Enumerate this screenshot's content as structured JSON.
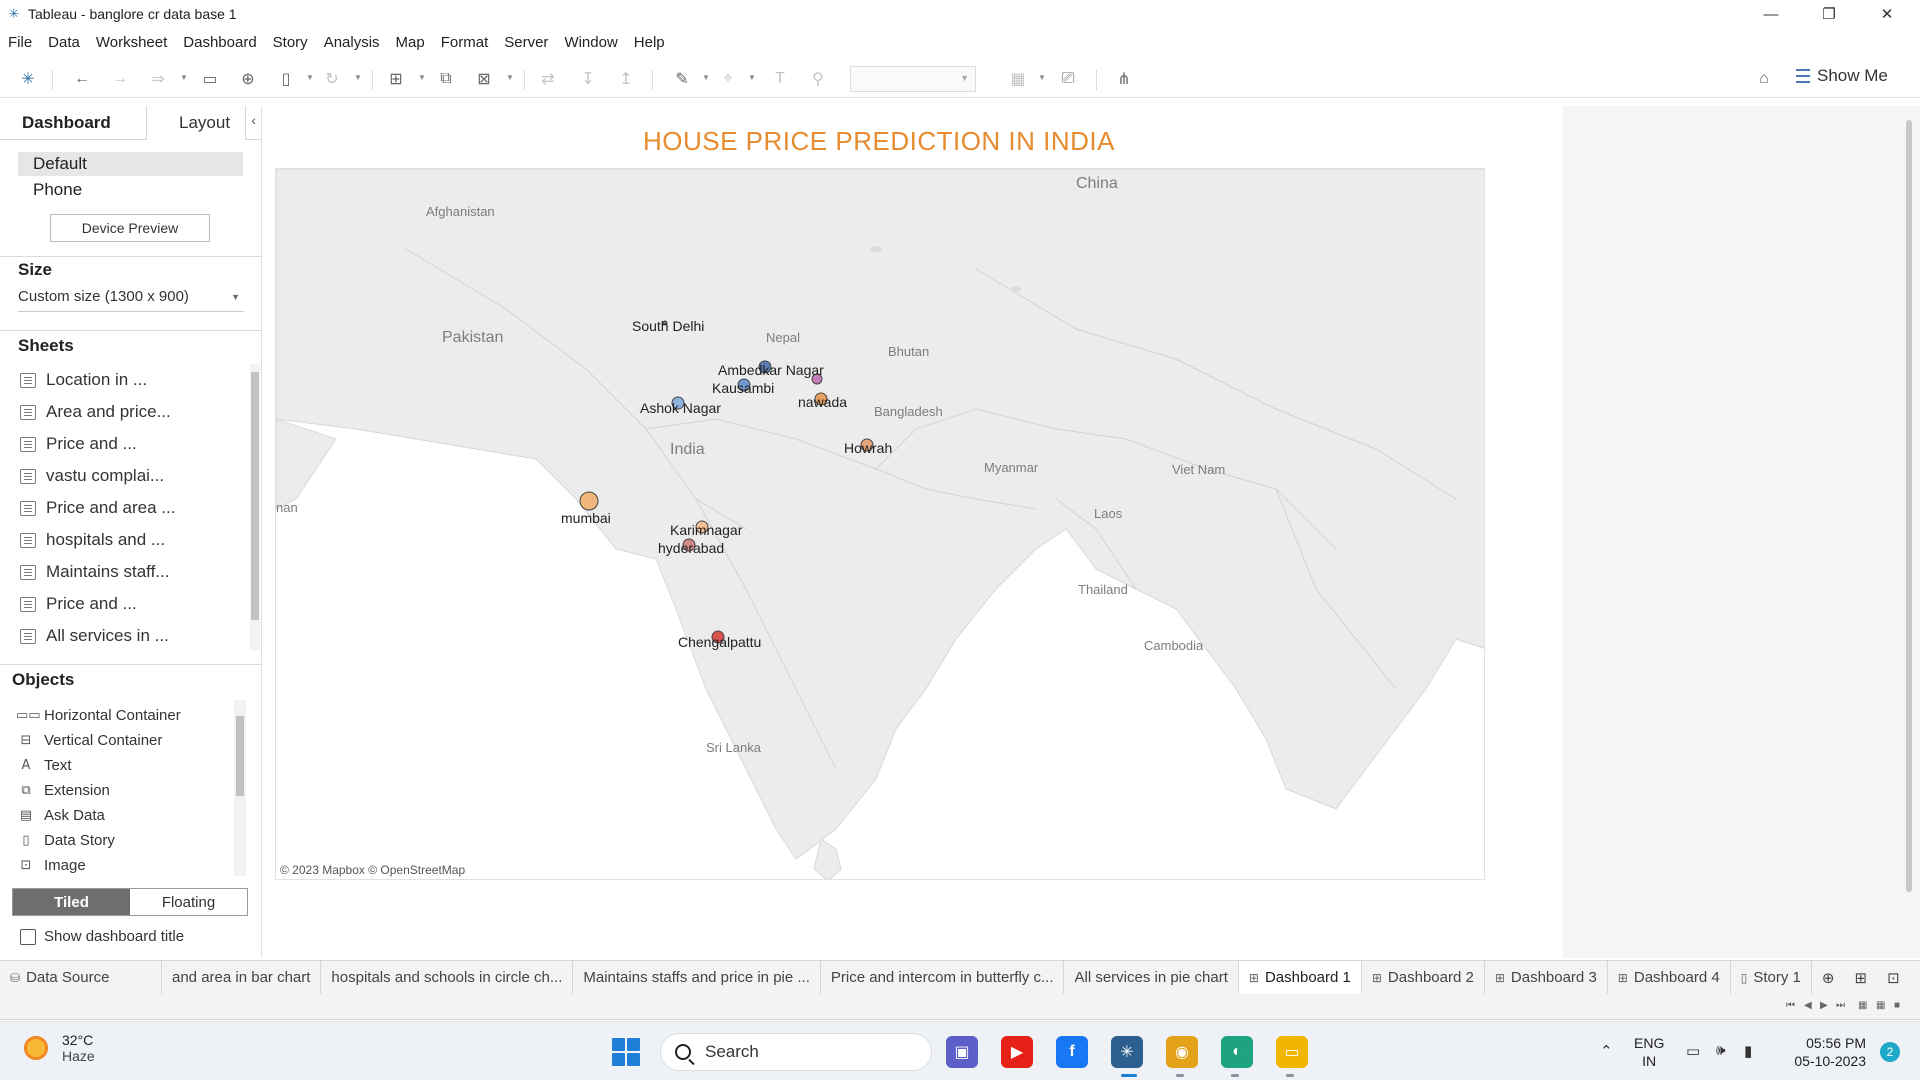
{
  "window": {
    "title": "Tableau - banglore cr data base 1",
    "minimize": "—",
    "maximize": "❐",
    "close": "✕"
  },
  "menu": [
    "File",
    "Data",
    "Worksheet",
    "Dashboard",
    "Story",
    "Analysis",
    "Map",
    "Format",
    "Server",
    "Window",
    "Help"
  ],
  "toolbar": {
    "show_me_label": "Show Me"
  },
  "left_panel": {
    "tabs": {
      "dashboard": "Dashboard",
      "layout": "Layout"
    },
    "devices": {
      "default": "Default",
      "phone": "Phone",
      "preview_button": "Device Preview"
    },
    "size": {
      "title": "Size",
      "value": "Custom size (1300 x 900)"
    },
    "sheets": {
      "title": "Sheets",
      "items": [
        "Location in ...",
        "Area and price...",
        "Price and ...",
        "vastu complai...",
        "Price and area ...",
        "hospitals and ...",
        "Maintains staff...",
        "Price and ...",
        "All services in ..."
      ]
    },
    "objects": {
      "title": "Objects",
      "items": [
        {
          "label": "Horizontal Container",
          "icon": "horizontal-container-icon"
        },
        {
          "label": "Vertical Container",
          "icon": "vertical-container-icon"
        },
        {
          "label": "Text",
          "icon": "text-icon"
        },
        {
          "label": "Extension",
          "icon": "extension-icon"
        },
        {
          "label": "Ask Data",
          "icon": "ask-data-icon"
        },
        {
          "label": "Data Story",
          "icon": "data-story-icon"
        },
        {
          "label": "Image",
          "icon": "image-icon"
        }
      ]
    },
    "layout_mode": {
      "tiled": "Tiled",
      "floating": "Floating",
      "selected": "Tiled"
    },
    "show_dashboard_title": "Show dashboard title"
  },
  "dashboard": {
    "title": "HOUSE PRICE PREDICTION IN INDIA",
    "map": {
      "attribution": "© 2023 Mapbox © OpenStreetMap",
      "countries": [
        "China",
        "Afghanistan",
        "Pakistan",
        "Nepal",
        "Bhutan",
        "Bangladesh",
        "India",
        "Myanmar",
        "Viet Nam",
        "Laos",
        "Thailand",
        "Cambodia",
        "Sri Lanka",
        "nan"
      ],
      "locations": [
        {
          "name": "South Delhi",
          "color": "#7a7a7a"
        },
        {
          "name": "Ambedkar Nagar",
          "color": "#5b7fb8"
        },
        {
          "name": "Kausambi",
          "color": "#6f9ad1"
        },
        {
          "name": "Ashok Nagar",
          "color": "#8fb2de"
        },
        {
          "name": "nawada",
          "color": "#e8a063"
        },
        {
          "name": "Howrah",
          "color": "#e6a57a"
        },
        {
          "name": "mumbai",
          "color": "#f0b77c"
        },
        {
          "name": "Karimnagar",
          "color": "#f2c199"
        },
        {
          "name": "hyderabad",
          "color": "#d08a8a"
        },
        {
          "name": "Chengalpattu",
          "color": "#d9534f"
        }
      ],
      "purple_marker_color": "#c27fb9"
    }
  },
  "sheet_tabs": {
    "data_source": "Data Source",
    "items": [
      "and area in bar chart",
      "hospitals and schools in circle ch...",
      "Maintains staffs and price in pie ...",
      "Price and intercom in butterfly c...",
      "All services in pie chart",
      "Dashboard 1",
      "Dashboard 2",
      "Dashboard 3",
      "Dashboard 4",
      "Story 1"
    ],
    "active": "Dashboard 1"
  },
  "taskbar": {
    "weather": {
      "temp": "32°C",
      "condition": "Haze"
    },
    "search_label": "Search",
    "apps": [
      {
        "name": "teams-icon",
        "color": "#5b5fc7",
        "glyph": "▣"
      },
      {
        "name": "youtube-icon",
        "color": "#e62117",
        "glyph": "▶"
      },
      {
        "name": "facebook-icon",
        "color": "#1877f2",
        "glyph": "f"
      },
      {
        "name": "tableau-icon",
        "color": "#2c5f8d",
        "glyph": "✳"
      },
      {
        "name": "chrome-icon",
        "color": "#e3a21a",
        "glyph": "◉"
      },
      {
        "name": "edge-icon",
        "color": "#1da37f",
        "glyph": "◐"
      },
      {
        "name": "file-explorer-icon",
        "color": "#f2b600",
        "glyph": "▭"
      }
    ],
    "language": {
      "top": "ENG",
      "bottom": "IN"
    },
    "clock": {
      "time": "05:56 PM",
      "date": "05-10-2023"
    },
    "notifications": "2"
  }
}
